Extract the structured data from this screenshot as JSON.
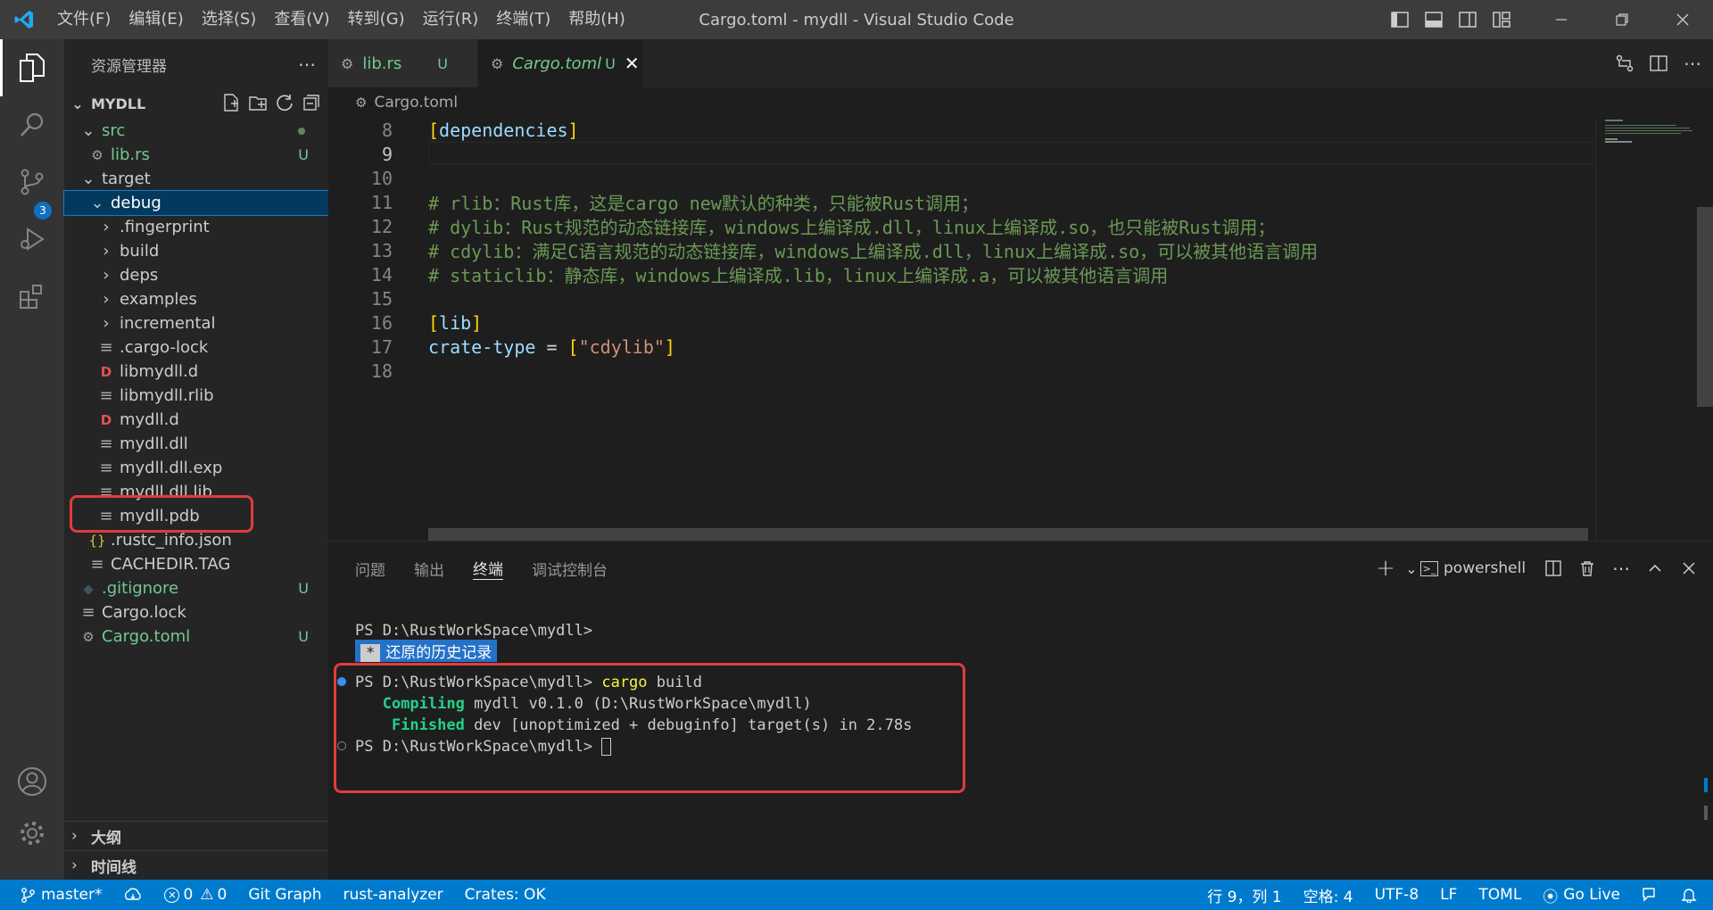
{
  "menu": [
    "文件(F)",
    "编辑(E)",
    "选择(S)",
    "查看(V)",
    "转到(G)",
    "运行(R)",
    "终端(T)",
    "帮助(H)"
  ],
  "window_title": "Cargo.toml - mydll - Visual Studio Code",
  "activity": {
    "source_control_badge": "3"
  },
  "sidebar": {
    "title": "资源管理器",
    "project": "MYDLL",
    "outline_label": "大纲",
    "timeline_label": "时间线",
    "tree": [
      {
        "label": "src",
        "depth": 1,
        "type": "folder-open",
        "git": "dot"
      },
      {
        "label": "lib.rs",
        "depth": 2,
        "type": "rust",
        "git": "U"
      },
      {
        "label": "target",
        "depth": 1,
        "type": "folder-open"
      },
      {
        "label": "debug",
        "depth": 2,
        "type": "folder-open",
        "selected": true
      },
      {
        "label": ".fingerprint",
        "depth": 3,
        "type": "folder"
      },
      {
        "label": "build",
        "depth": 3,
        "type": "folder"
      },
      {
        "label": "deps",
        "depth": 3,
        "type": "folder"
      },
      {
        "label": "examples",
        "depth": 3,
        "type": "folder"
      },
      {
        "label": "incremental",
        "depth": 3,
        "type": "folder"
      },
      {
        "label": ".cargo-lock",
        "depth": 3,
        "type": "file"
      },
      {
        "label": "libmydll.d",
        "depth": 3,
        "type": "dfile"
      },
      {
        "label": "libmydll.rlib",
        "depth": 3,
        "type": "file"
      },
      {
        "label": "mydll.d",
        "depth": 3,
        "type": "dfile"
      },
      {
        "label": "mydll.dll",
        "depth": 3,
        "type": "file"
      },
      {
        "label": "mydll.dll.exp",
        "depth": 3,
        "type": "file"
      },
      {
        "label": "mydll.dll.lib",
        "depth": 3,
        "type": "file"
      },
      {
        "label": "mydll.pdb",
        "depth": 3,
        "type": "file"
      },
      {
        "label": ".rustc_info.json",
        "depth": 2,
        "type": "json"
      },
      {
        "label": "CACHEDIR.TAG",
        "depth": 2,
        "type": "file"
      },
      {
        "label": ".gitignore",
        "depth": 1,
        "type": "git",
        "git": "U"
      },
      {
        "label": "Cargo.lock",
        "depth": 1,
        "type": "file"
      },
      {
        "label": "Cargo.toml",
        "depth": 1,
        "type": "gear",
        "git": "U"
      }
    ]
  },
  "tabs": [
    {
      "label": "lib.rs",
      "status": "U",
      "active": false
    },
    {
      "label": "Cargo.toml",
      "status": "U",
      "active": true
    }
  ],
  "breadcrumb": "Cargo.toml",
  "code_lines": [
    {
      "n": "8",
      "tokens": [
        [
          "brk",
          "["
        ],
        [
          "key",
          "dependencies"
        ],
        [
          "brk",
          "]"
        ]
      ]
    },
    {
      "n": "9",
      "tokens": [],
      "current": true
    },
    {
      "n": "10",
      "tokens": []
    },
    {
      "n": "11",
      "tokens": [
        [
          "cmt",
          "# rlib：Rust库，这是cargo new默认的种类，只能被Rust调用；"
        ]
      ]
    },
    {
      "n": "12",
      "tokens": [
        [
          "cmt",
          "# dylib：Rust规范的动态链接库，windows上编译成.dll，linux上编译成.so，也只能被Rust调用；"
        ]
      ]
    },
    {
      "n": "13",
      "tokens": [
        [
          "cmt",
          "# cdylib：满足C语言规范的动态链接库，windows上编译成.dll，linux上编译成.so，可以被其他语言调用"
        ]
      ]
    },
    {
      "n": "14",
      "tokens": [
        [
          "cmt",
          "# staticlib：静态库，windows上编译成.lib，linux上编译成.a，可以被其他语言调用"
        ]
      ]
    },
    {
      "n": "15",
      "tokens": []
    },
    {
      "n": "16",
      "tokens": [
        [
          "brk",
          "["
        ],
        [
          "key",
          "lib"
        ],
        [
          "brk",
          "]"
        ]
      ]
    },
    {
      "n": "17",
      "tokens": [
        [
          "key",
          "crate-type"
        ],
        [
          "eq",
          " = "
        ],
        [
          "brk",
          "["
        ],
        [
          "str",
          "\"cdylib\""
        ],
        [
          "brk",
          "]"
        ]
      ]
    },
    {
      "n": "18",
      "tokens": []
    }
  ],
  "panel": {
    "tabs": [
      "问题",
      "输出",
      "终端",
      "调试控制台"
    ],
    "active_tab": "终端",
    "shell": "powershell"
  },
  "terminal": {
    "prompt1": "PS D:\\RustWorkSpace\\mydll>",
    "restore_star": "*",
    "restore_text": "还原的历史记录",
    "prompt2": "PS D:\\RustWorkSpace\\mydll> ",
    "cmd": "cargo",
    "cmd_arg": " build",
    "compiling_label": "   Compiling",
    "compiling_text": " mydll v0.1.0 (D:\\RustWorkSpace\\mydll)",
    "finished_label": "    Finished",
    "finished_text": " dev [unoptimized + debuginfo] target(s) in 2.78s",
    "prompt3": "PS D:\\RustWorkSpace\\mydll> "
  },
  "status": {
    "branch": "master*",
    "errors": "0",
    "warnings": "0",
    "git_graph": "Git Graph",
    "rust_analyzer": "rust-analyzer",
    "crates": "Crates: OK",
    "position": "行 9，列 1",
    "spaces": "空格: 4",
    "encoding": "UTF-8",
    "eol": "LF",
    "language": "TOML",
    "golive": "Go Live"
  },
  "colors": {
    "accent": "#007acc",
    "highlight_box": "#e03c3c"
  }
}
